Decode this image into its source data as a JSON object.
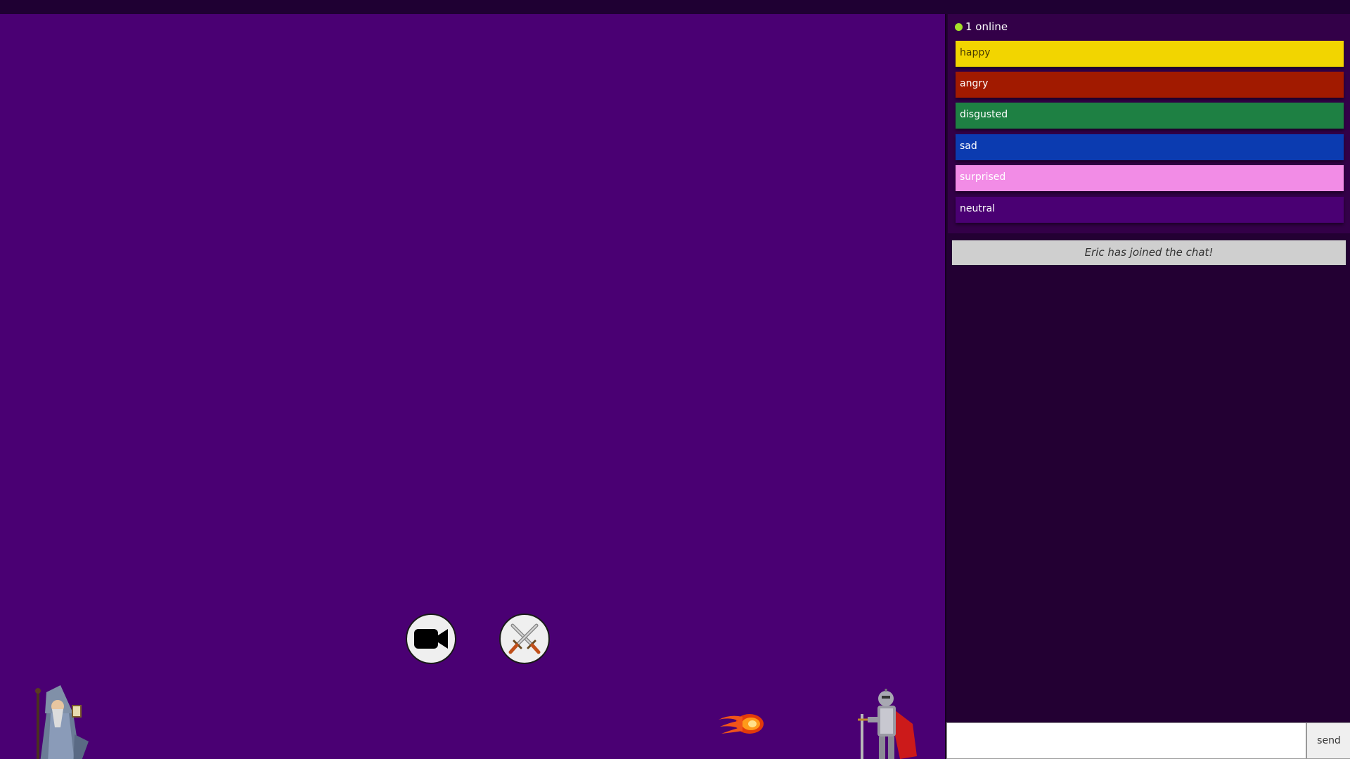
{
  "sidebar": {
    "online_text": "1 online",
    "emotions": [
      {
        "label": "happy",
        "color": "#f2d500"
      },
      {
        "label": "angry",
        "color": "#a11a00"
      },
      {
        "label": "disgusted",
        "color": "#1e8043"
      },
      {
        "label": "sad",
        "color": "#0b3bb0"
      },
      {
        "label": "surprised",
        "color": "#f28ce6"
      },
      {
        "label": "neutral",
        "color": "#4a0073"
      }
    ],
    "messages": [
      {
        "text": "Eric has joined the chat!"
      }
    ],
    "chat_input": {
      "value": "",
      "placeholder": ""
    },
    "send_label": "send"
  },
  "game": {
    "background": "#4a0073",
    "buttons": [
      {
        "icon": "video-camera-icon"
      },
      {
        "icon": "crossed-swords-icon"
      }
    ],
    "sprites": [
      "wizard",
      "fireball",
      "knight"
    ]
  }
}
